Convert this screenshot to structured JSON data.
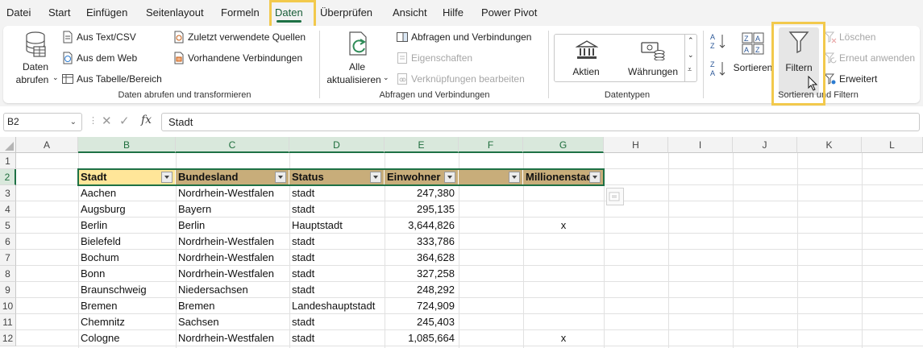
{
  "menu": {
    "tabs": [
      "Datei",
      "Start",
      "Einfügen",
      "Seitenlayout",
      "Formeln",
      "Daten",
      "Überprüfen",
      "Ansicht",
      "Hilfe",
      "Power Pivot"
    ],
    "active": "Daten"
  },
  "ribbon": {
    "get_data": {
      "line1": "Daten",
      "line2": "abrufen"
    },
    "from_text_csv": "Aus Text/CSV",
    "from_web": "Aus dem Web",
    "from_table": "Aus Tabelle/Bereich",
    "recent_sources": "Zuletzt verwendete Quellen",
    "existing_connections": "Vorhandene Verbindungen",
    "group_get_transform": "Daten abrufen und transformieren",
    "refresh_all": {
      "line1": "Alle",
      "line2": "aktualisieren"
    },
    "queries_connections": "Abfragen und Verbindungen",
    "properties": "Eigenschaften",
    "edit_links": "Verknüpfungen bearbeiten",
    "group_queries": "Abfragen und Verbindungen",
    "stocks": "Aktien",
    "currencies": "Währungen",
    "group_datatypes": "Datentypen",
    "sort": "Sortieren",
    "filter": "Filtern",
    "clear": "Löschen",
    "reapply": "Erneut anwenden",
    "advanced": "Erweitert",
    "group_sort_filter": "Sortieren und Filtern"
  },
  "formula_bar": {
    "name_box": "B2",
    "fx": "fx",
    "content": "Stadt"
  },
  "grid": {
    "columns": [
      "A",
      "B",
      "C",
      "D",
      "E",
      "F",
      "G",
      "H",
      "I",
      "J",
      "K",
      "L"
    ],
    "rows": [
      "1",
      "2",
      "3",
      "4",
      "5",
      "6",
      "7",
      "8",
      "9",
      "10",
      "11",
      "12"
    ],
    "table_headers": [
      "Stadt",
      "Bundesland",
      "Status",
      "Einwohner",
      "",
      "Millionenstadt"
    ],
    "table_rows": [
      [
        "Aachen",
        "Nordrhein-Westfalen",
        "stadt",
        "247,380",
        "",
        ""
      ],
      [
        "Augsburg",
        "Bayern",
        "stadt",
        "295,135",
        "",
        ""
      ],
      [
        "Berlin",
        "Berlin",
        "Hauptstadt",
        "3,644,826",
        "",
        "x"
      ],
      [
        "Bielefeld",
        "Nordrhein-Westfalen",
        "stadt",
        "333,786",
        "",
        ""
      ],
      [
        "Bochum",
        "Nordrhein-Westfalen",
        "stadt",
        "364,628",
        "",
        ""
      ],
      [
        "Bonn",
        "Nordrhein-Westfalen",
        "stadt",
        "327,258",
        "",
        ""
      ],
      [
        "Braunschweig",
        "Niedersachsen",
        "stadt",
        "248,292",
        "",
        ""
      ],
      [
        "Bremen",
        "Bremen",
        "Landeshauptstadt",
        "724,909",
        "",
        ""
      ],
      [
        "Chemnitz",
        "Sachsen",
        "stadt",
        "245,403",
        "",
        ""
      ],
      [
        "Cologne",
        "Nordrhein-Westfalen",
        "stadt",
        "1,085,664",
        "",
        "x"
      ]
    ]
  },
  "colors": {
    "accent": "#1e7145",
    "highlight": "#f2c94c",
    "header_fill": "#c8ad7a",
    "active_header_fill": "#ffe699"
  }
}
